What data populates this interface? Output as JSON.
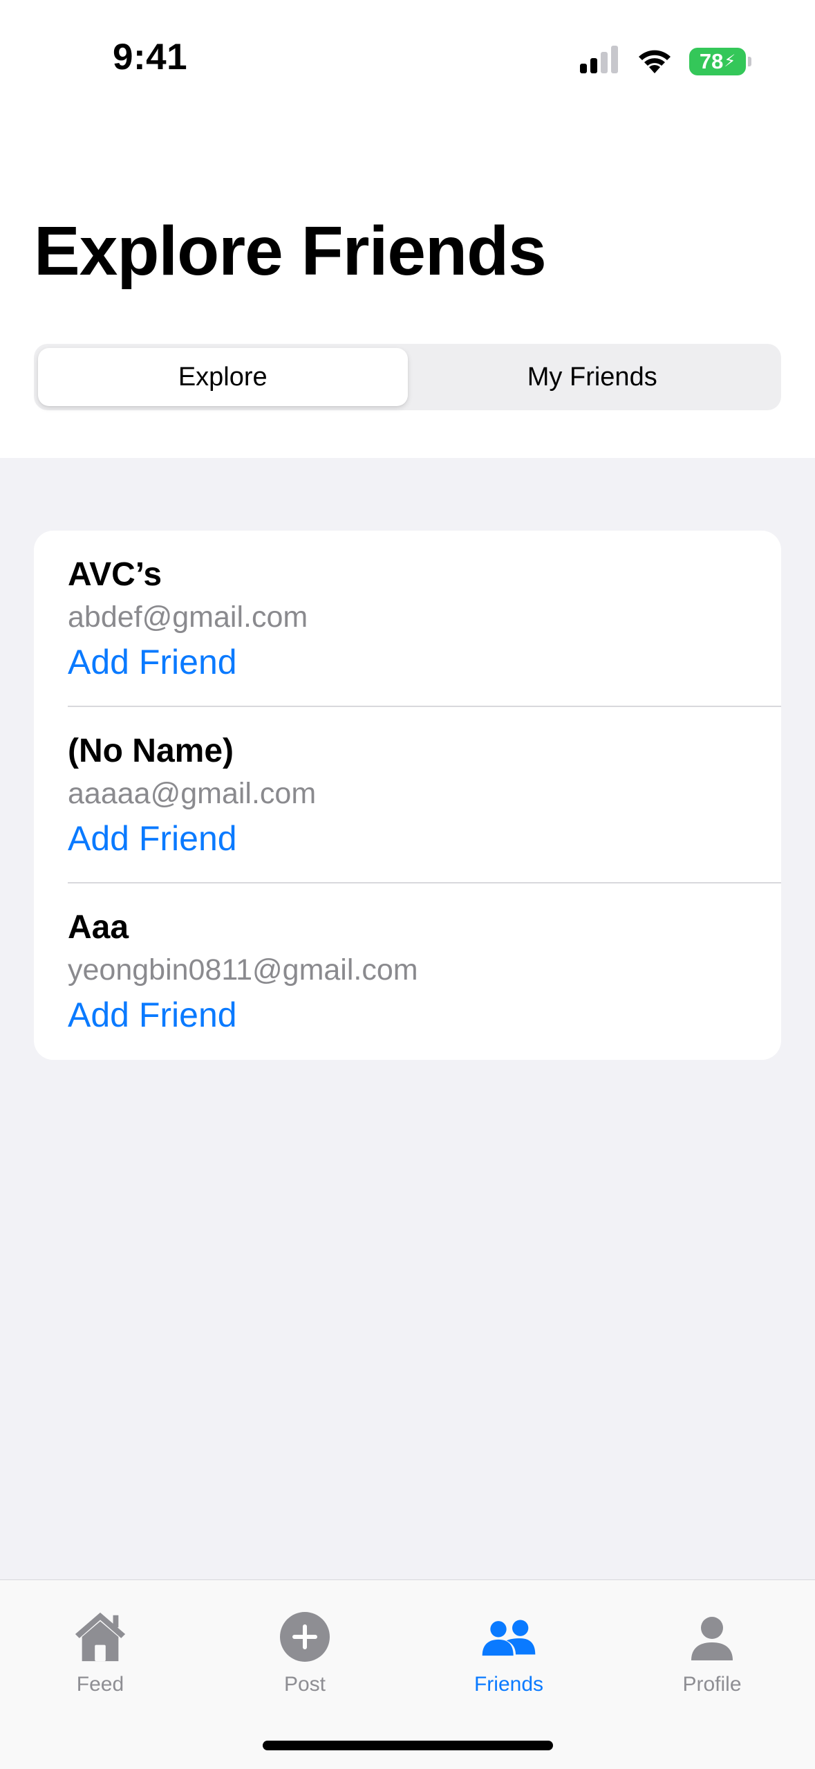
{
  "status_bar": {
    "time": "9:41",
    "battery": "78",
    "battery_color": "#34c759"
  },
  "header": {
    "title": "Explore Friends"
  },
  "segments": [
    {
      "label": "Explore",
      "active": true
    },
    {
      "label": "My Friends",
      "active": false
    }
  ],
  "friends": [
    {
      "name": "AVC’s",
      "email": "abdef@gmail.com",
      "action": "Add Friend"
    },
    {
      "name": "(No Name)",
      "email": "aaaaa@gmail.com",
      "action": "Add Friend"
    },
    {
      "name": "Aaa",
      "email": "yeongbin0811@gmail.com",
      "action": "Add Friend"
    }
  ],
  "tab_bar": {
    "items": [
      {
        "label": "Feed",
        "icon": "house-icon",
        "active": false
      },
      {
        "label": "Post",
        "icon": "plus-circle-icon",
        "active": false
      },
      {
        "label": "Friends",
        "icon": "people-icon",
        "active": true
      },
      {
        "label": "Profile",
        "icon": "person-icon",
        "active": false
      }
    ]
  },
  "colors": {
    "accent": "#0a7aff",
    "inactive": "#8e8e93",
    "background": "#f2f2f6"
  }
}
